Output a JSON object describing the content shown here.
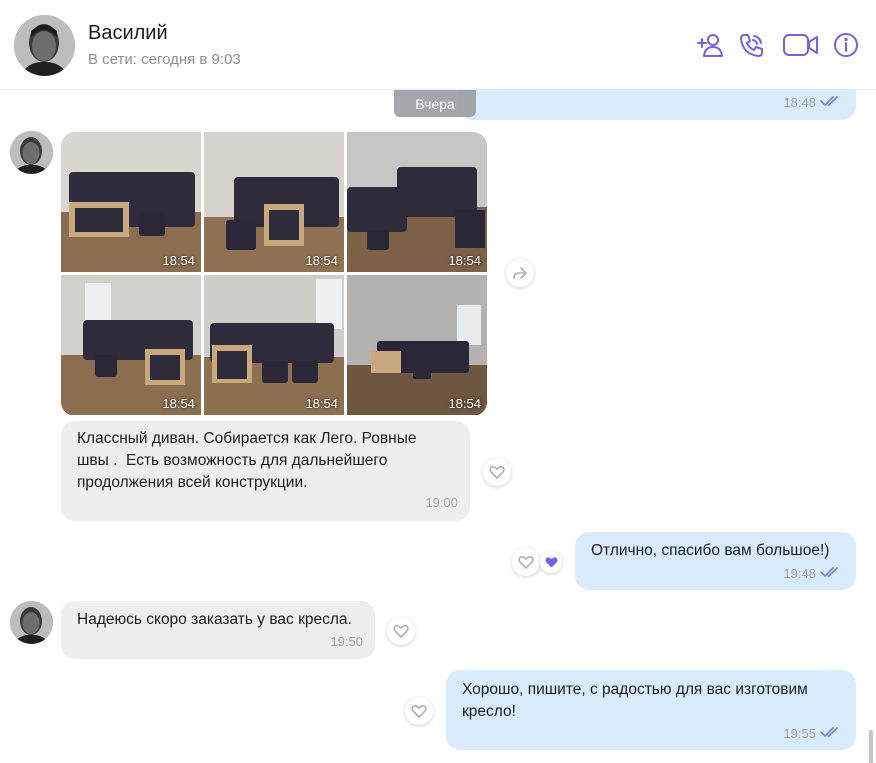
{
  "header": {
    "contact_name": "Василий",
    "contact_status": "В сети: сегодня в 9:03",
    "actions": [
      "add-contact-icon",
      "voice-call-icon",
      "video-call-icon",
      "info-icon"
    ]
  },
  "chat": {
    "prev_message_time": "18:48",
    "date_separator": "Вчера",
    "photos": [
      {
        "time": "18:54"
      },
      {
        "time": "18:54"
      },
      {
        "time": "18:54"
      },
      {
        "time": "18:54"
      },
      {
        "time": "18:54"
      },
      {
        "time": "18:54"
      }
    ],
    "messages": [
      {
        "direction": "in",
        "text": "Классный диван. Собирается как Лего. Ровные\nшвы .  Есть возможность для дальнейшего\nпродолжения всей конструкции.",
        "time": "19:00"
      },
      {
        "direction": "out",
        "text": "Отлично, спасибо вам большое!)",
        "time": "19:48"
      },
      {
        "direction": "in",
        "text": "Надеюсь скоро заказать у вас кресла.",
        "time": "19:50"
      },
      {
        "direction": "out",
        "text": "Хорошо, пишите, с радостью для вас изготовим\nкресло!",
        "time": "19:55"
      }
    ]
  },
  "colors": {
    "accent": "#7360f2",
    "outgoing_bubble": "#d8ebff",
    "incoming_bubble": "#eeeef1"
  }
}
